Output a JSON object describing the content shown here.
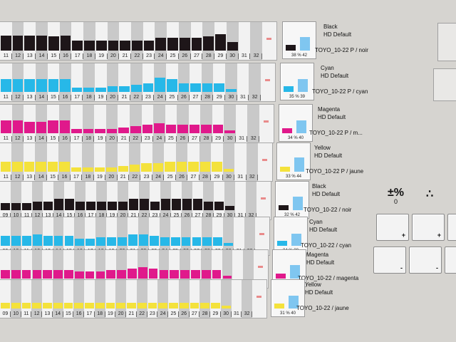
{
  "colors": {
    "black": "#1e1619",
    "cyan": "#27b8e8",
    "magenta": "#e0198b",
    "yellow": "#f4e23c",
    "ref": "#7fc6f0"
  },
  "zones_top": [
    "11",
    "12",
    "13",
    "14",
    "15",
    "16",
    "17",
    "18",
    "19",
    "20",
    "21",
    "22",
    "23",
    "24",
    "25",
    "26",
    "27",
    "28",
    "29",
    "30",
    "31",
    "32"
  ],
  "zones_bottom": [
    "09",
    "10",
    "11",
    "12",
    "13",
    "14",
    "15",
    "16",
    "17",
    "18",
    "19",
    "20",
    "21",
    "22",
    "23",
    "24",
    "25",
    "26",
    "27",
    "28",
    "29",
    "30",
    "31",
    "32"
  ],
  "units": [
    {
      "name": "Black",
      "profile": "HD Default",
      "paper": "TOYO_10-22 P / noir",
      "color_key": "black",
      "pct_left": "38",
      "pct_right": "42",
      "levels": [
        0.55,
        0.55,
        0.55,
        0.55,
        0.5,
        0.55,
        0.35,
        0.35,
        0.35,
        0.35,
        0.35,
        0.35,
        0.35,
        0.45,
        0.45,
        0.45,
        0.45,
        0.5,
        0.6,
        0.3,
        0,
        0
      ]
    },
    {
      "name": "Cyan",
      "profile": "HD Default",
      "paper": "TOYO_10-22 P / cyan",
      "color_key": "cyan",
      "pct_left": "35",
      "pct_right": "39",
      "levels": [
        0.45,
        0.45,
        0.45,
        0.45,
        0.45,
        0.45,
        0.15,
        0.15,
        0.15,
        0.2,
        0.2,
        0.25,
        0.3,
        0.5,
        0.45,
        0.3,
        0.3,
        0.3,
        0.3,
        0.1,
        0,
        0
      ]
    },
    {
      "name": "Magenta",
      "profile": "HD Default",
      "paper": "TOYO_10-22 P / m...",
      "color_key": "magenta",
      "pct_left": "34",
      "pct_right": "40",
      "levels": [
        0.45,
        0.45,
        0.4,
        0.4,
        0.45,
        0.45,
        0.15,
        0.15,
        0.15,
        0.15,
        0.2,
        0.25,
        0.3,
        0.35,
        0.3,
        0.3,
        0.3,
        0.3,
        0.3,
        0.1,
        0,
        0
      ]
    },
    {
      "name": "Yellow",
      "profile": "HD Default",
      "paper": "TOYO_10-22 P / jaune",
      "color_key": "yellow",
      "pct_left": "33",
      "pct_right": "44",
      "levels": [
        0.35,
        0.35,
        0.35,
        0.35,
        0.35,
        0.35,
        0.15,
        0.15,
        0.15,
        0.15,
        0.2,
        0.25,
        0.3,
        0.3,
        0.35,
        0.35,
        0.35,
        0.35,
        0.35,
        0.1,
        0,
        0
      ]
    },
    {
      "name": "Black",
      "profile": "HD Default",
      "paper": "TOYO_10-22 / noir",
      "color_key": "black",
      "pct_left": "32",
      "pct_right": "42",
      "levels": [
        0.25,
        0.25,
        0.25,
        0.3,
        0.3,
        0.4,
        0.4,
        0.3,
        0.3,
        0.3,
        0.3,
        0.3,
        0.4,
        0.4,
        0.3,
        0.4,
        0.4,
        0.4,
        0.4,
        0.3,
        0.3,
        0.15,
        0,
        0
      ]
    },
    {
      "name": "Cyan",
      "profile": "HD Default",
      "paper": "TOYO_10-22 / cyan",
      "color_key": "cyan",
      "pct_left": "34",
      "pct_right": "38",
      "levels": [
        0.35,
        0.35,
        0.35,
        0.4,
        0.35,
        0.35,
        0.35,
        0.25,
        0.25,
        0.3,
        0.3,
        0.3,
        0.4,
        0.4,
        0.35,
        0.3,
        0.3,
        0.3,
        0.3,
        0.3,
        0.3,
        0.1,
        0,
        0
      ]
    },
    {
      "name": "Magenta",
      "profile": "HD Default",
      "paper": "TOYO_10-22 / magenta",
      "color_key": "magenta",
      "pct_left": "32",
      "pct_right": "42",
      "levels": [
        0.3,
        0.3,
        0.3,
        0.3,
        0.3,
        0.3,
        0.3,
        0.25,
        0.25,
        0.25,
        0.3,
        0.3,
        0.35,
        0.4,
        0.35,
        0.3,
        0.3,
        0.3,
        0.3,
        0.3,
        0.3,
        0.1,
        0,
        0
      ]
    },
    {
      "name": "Yellow",
      "profile": "HD Default",
      "paper": "TOYO_10-22 / jaune",
      "color_key": "yellow",
      "pct_left": "31",
      "pct_right": "40",
      "levels": [
        0.2,
        0.2,
        0.2,
        0.2,
        0.2,
        0.2,
        0.2,
        0.2,
        0.2,
        0.2,
        0.2,
        0.2,
        0.2,
        0.2,
        0.2,
        0.2,
        0.2,
        0.2,
        0.2,
        0.2,
        0.2,
        0.1,
        0,
        0
      ]
    }
  ],
  "controls": {
    "plus_minus_symbol": "±%",
    "plus_minus_sub": "0",
    "dots_symbol": "∴",
    "plus_label": "+",
    "minus_label": "-"
  }
}
